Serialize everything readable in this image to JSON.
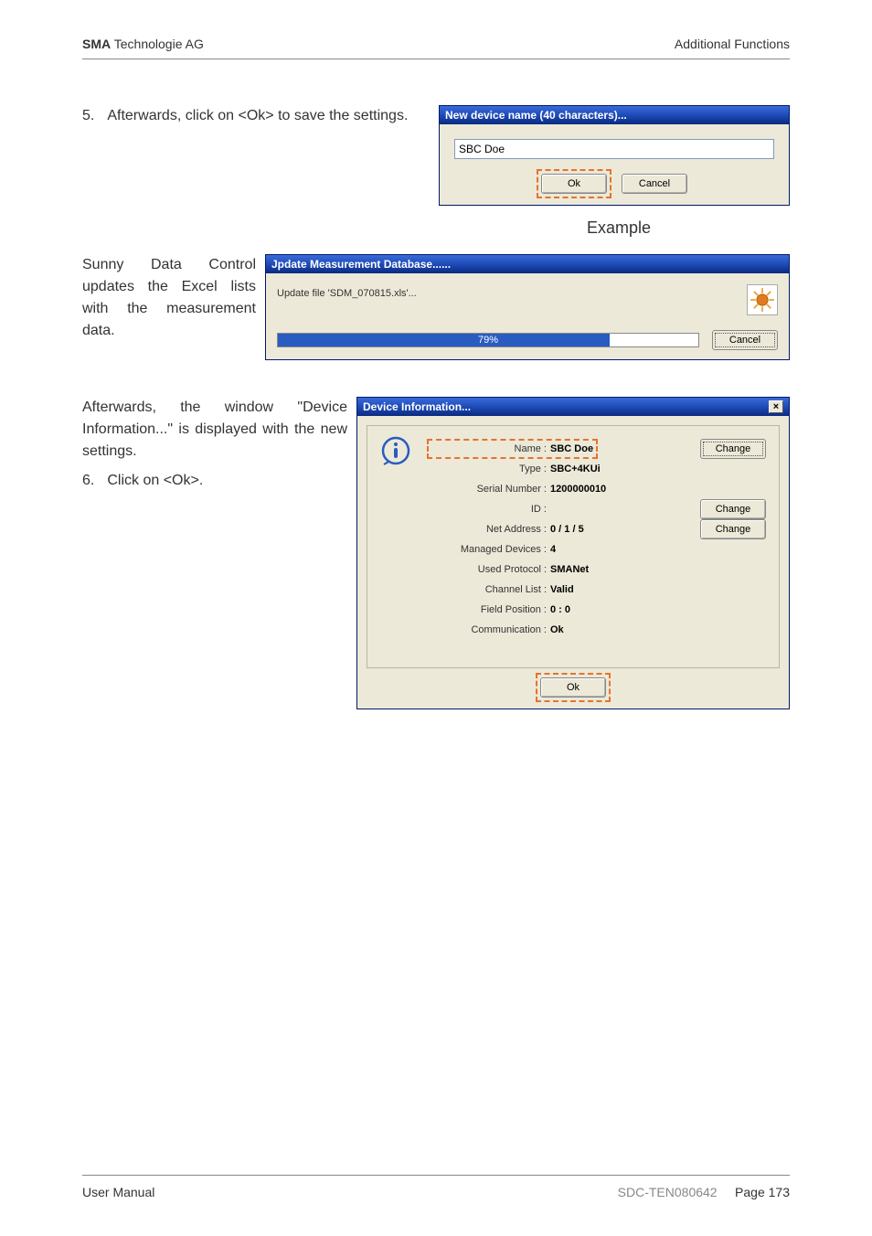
{
  "header": {
    "company_bold": "SMA",
    "company_rest": " Technologie AG",
    "right": "Additional Functions"
  },
  "step5": {
    "num": "5.",
    "text": "Afterwards, click on <Ok> to save the settings."
  },
  "dlg1": {
    "title": "New device name (40 characters)...",
    "input_value": "SBC Doe",
    "ok": "Ok",
    "cancel": "Cancel"
  },
  "example_label": "Example",
  "update_text": "Sunny Data Control updates the Excel lists with the measurement data.",
  "dlg2": {
    "title": "Jpdate Measurement Database......",
    "file_text": "Update file 'SDM_070815.xls'...",
    "progress_pct": "79%",
    "cancel": "Cancel"
  },
  "devinfo_text": "Afterwards, the window \"Device Information...\" is displayed with the new settings.",
  "step6": {
    "num": "6.",
    "text": "Click on <Ok>."
  },
  "dlg3": {
    "title": "Device Information...",
    "close": "×",
    "rows": {
      "name_label": "Name :",
      "name_value": "SBC Doe",
      "type_label": "Type :",
      "type_value": "SBC+4KUi",
      "serial_label": "Serial Number :",
      "serial_value": "1200000010",
      "id_label": "ID :",
      "id_value": "",
      "net_label": "Net Address :",
      "net_value": "0 / 1 / 5",
      "managed_label": "Managed Devices :",
      "managed_value": "4",
      "protocol_label": "Used Protocol :",
      "protocol_value": "SMANet",
      "channel_label": "Channel List :",
      "channel_value": "Valid",
      "field_label": "Field Position :",
      "field_value": "0 : 0",
      "comm_label": "Communication :",
      "comm_value": "Ok"
    },
    "change": "Change",
    "ok": "Ok"
  },
  "footer": {
    "left": "User Manual",
    "mid": "SDC-TEN080642",
    "page_label": "Page ",
    "page_num": "173"
  }
}
